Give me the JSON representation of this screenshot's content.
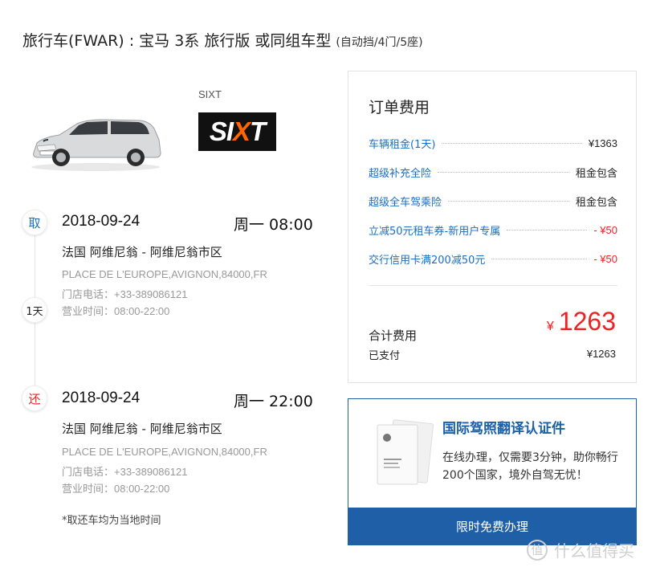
{
  "header": {
    "title": "旅行车(FWAR) : 宝马 3系 旅行版 或同组车型",
    "subtitle": "(自动挡/4门/5座)"
  },
  "vendor": {
    "name": "SIXT",
    "logo_text_a": "SI",
    "logo_text_b": "X",
    "logo_text_c": "T"
  },
  "pickup": {
    "badge": "取",
    "date": "2018-09-24",
    "time": "周一 08:00",
    "city": "法国 阿维尼翁 - 阿维尼翁市区",
    "address": "PLACE DE L'EUROPE,AVIGNON,84000,FR",
    "phone": "门店电话：+33-389086121",
    "hours": "营业时间：08:00-22:00"
  },
  "duration": {
    "badge": "1天"
  },
  "return": {
    "badge": "还",
    "date": "2018-09-24",
    "time": "周一 22:00",
    "city": "法国 阿维尼翁 - 阿维尼翁市区",
    "address": "PLACE DE L'EUROPE,AVIGNON,84000,FR",
    "phone": "门店电话：+33-389086121",
    "hours": "营业时间：08:00-22:00"
  },
  "note": "*取还车均为当地时间",
  "fees": {
    "title": "订单费用",
    "rows": [
      {
        "label": "车辆租金(1天)",
        "value": "¥1363",
        "color": "#222222"
      },
      {
        "label": "超级补充全险",
        "value": "租金包含",
        "color": "#222222"
      },
      {
        "label": "超级全车驾乘险",
        "value": "租金包含",
        "color": "#222222"
      },
      {
        "label": "立减50元租车券-新用户专属",
        "value": "- ¥50",
        "color": "#e22222"
      },
      {
        "label": "交行信用卡满200减50元",
        "value": "- ¥50",
        "color": "#e22222"
      }
    ],
    "total_label": "合计费用",
    "total_currency": "¥",
    "total_value": "1263",
    "paid_label": "已支付",
    "paid_value": "¥1263"
  },
  "promo": {
    "title": "国际驾照翻译认证件",
    "desc": "在线办理，仅需要3分钟，助你畅行200个国家，境外自驾无忧！",
    "button": "限时免费办理"
  },
  "watermark": {
    "icon": "值",
    "text": "什么值得买"
  },
  "colors": {
    "accent": "#1e5fa8",
    "link": "#1a6fc4",
    "price_red": "#e22222"
  }
}
